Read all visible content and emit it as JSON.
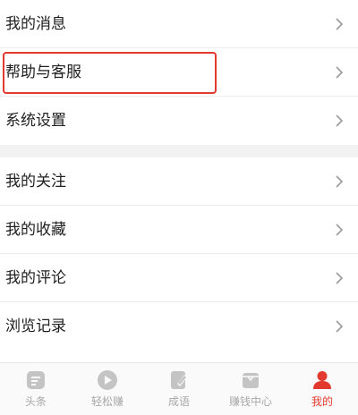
{
  "menu": {
    "group1": [
      {
        "label": "我的消息"
      },
      {
        "label": "帮助与客服"
      },
      {
        "label": "系统设置"
      }
    ],
    "group2": [
      {
        "label": "我的关注"
      },
      {
        "label": "我的收藏"
      },
      {
        "label": "我的评论"
      },
      {
        "label": "浏览记录"
      }
    ]
  },
  "tabs": [
    {
      "label": "头条",
      "icon": "news-icon"
    },
    {
      "label": "轻松赚",
      "icon": "play-icon"
    },
    {
      "label": "成语",
      "icon": "edit-icon"
    },
    {
      "label": "赚钱中心",
      "icon": "box-icon"
    },
    {
      "label": "我的",
      "icon": "user-icon",
      "active": true
    }
  ],
  "colors": {
    "accent": "#e23a2e",
    "tab_inactive": "#a8a8a8",
    "section_gap": "#f2f2f2"
  }
}
